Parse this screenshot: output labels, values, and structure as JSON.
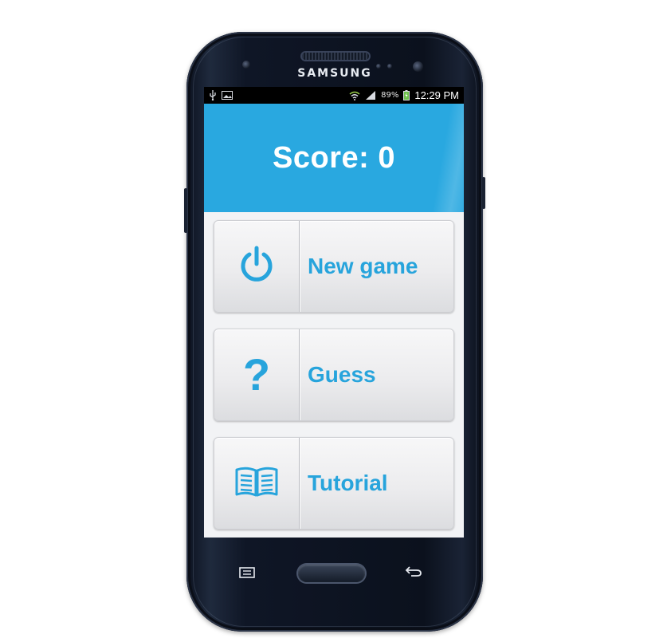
{
  "device": {
    "brand": "SAMSUNG"
  },
  "statusbar": {
    "left_icons": [
      "usb-icon",
      "image-icon"
    ],
    "right_icons": [
      "wifi-icon",
      "signal-icon",
      "battery-icon"
    ],
    "battery_percent": "89%",
    "time": "12:29 PM"
  },
  "header": {
    "score_text": "Score: 0",
    "color": "#29a8e0"
  },
  "menu": {
    "accent_color": "#27a4dc",
    "items": [
      {
        "icon": "power-icon",
        "label": "New game"
      },
      {
        "icon": "question-icon",
        "glyph": "?",
        "label": "Guess"
      },
      {
        "icon": "book-icon",
        "label": "Tutorial"
      }
    ]
  },
  "softkeys": {
    "left": "menu-icon",
    "center": "home-button",
    "right": "back-icon"
  }
}
